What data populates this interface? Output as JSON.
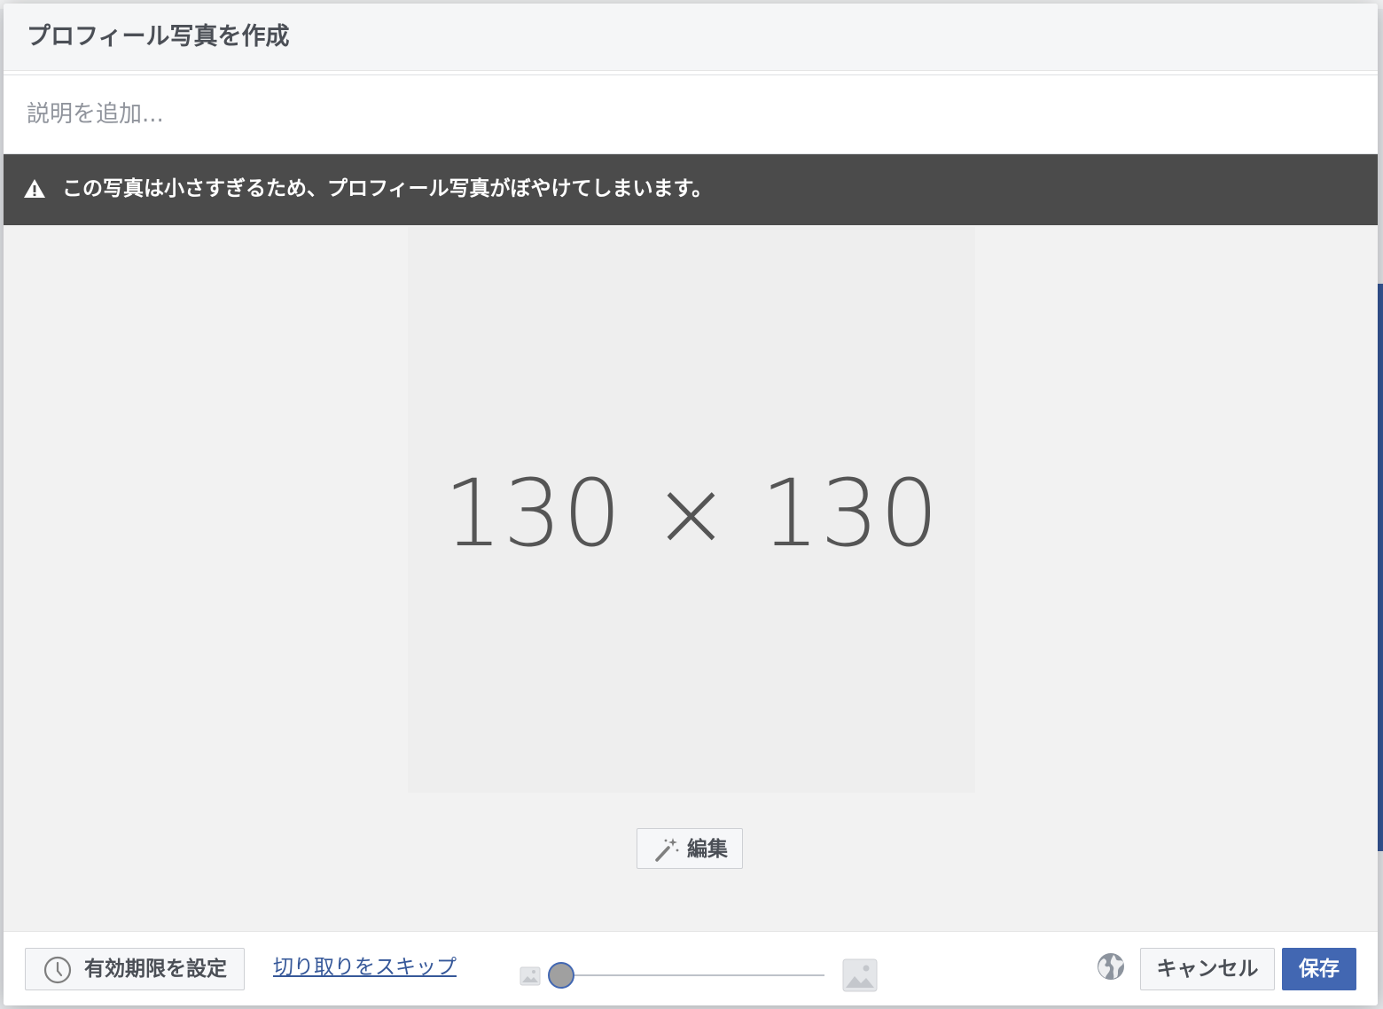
{
  "dialog": {
    "title": "プロフィール写真を作成"
  },
  "caption": {
    "placeholder": "説明を追加..."
  },
  "warning": {
    "icon": "warning-icon",
    "text": "この写真は小さすぎるため、プロフィール写真がぼやけてしまいます。"
  },
  "preview": {
    "placeholder_text": "130 × 130"
  },
  "edit": {
    "icon": "magic-wand-icon",
    "label": "編集"
  },
  "footer": {
    "expire_icon": "clock-icon",
    "expire_label": "有効期限を設定",
    "skip_crop_label": "切り取りをスキップ",
    "zoom_level": 0,
    "privacy_icon": "globe-icon",
    "cancel_label": "キャンセル",
    "save_label": "保存"
  },
  "colors": {
    "primary": "#4267b2",
    "link": "#365899",
    "warning_bg": "#4b4b4b"
  }
}
